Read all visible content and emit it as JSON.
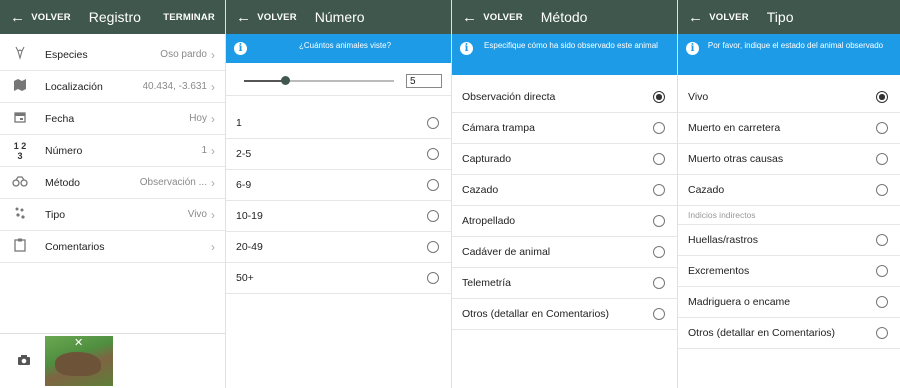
{
  "registro": {
    "back_label": "VOLVER",
    "title": "Registro",
    "action": "TERMINAR",
    "items": [
      {
        "icon": "deer-icon",
        "label": "Especies",
        "value": "Oso pardo"
      },
      {
        "icon": "map-icon",
        "label": "Localización",
        "value": "40.434, -3.631"
      },
      {
        "icon": "calendar-icon",
        "label": "Fecha",
        "value": "Hoy"
      },
      {
        "icon": "numbers-icon",
        "label": "Número",
        "value": "1"
      },
      {
        "icon": "binoculars-icon",
        "label": "Método",
        "value": "Observación ..."
      },
      {
        "icon": "paw-icon",
        "label": "Tipo",
        "value": "Vivo"
      },
      {
        "icon": "clipboard-icon",
        "label": "Comentarios",
        "value": ""
      }
    ],
    "icon_numbers": "1 2 3"
  },
  "numero": {
    "back_label": "VOLVER",
    "title": "Número",
    "info": "¿Cuántos animales viste?",
    "slider_value": "5",
    "slider_fraction": 0.27,
    "options": [
      {
        "label": "1",
        "selected": false
      },
      {
        "label": "2-5",
        "selected": false
      },
      {
        "label": "6-9",
        "selected": false
      },
      {
        "label": "10-19",
        "selected": false
      },
      {
        "label": "20-49",
        "selected": false
      },
      {
        "label": "50+",
        "selected": false
      }
    ]
  },
  "metodo": {
    "back_label": "VOLVER",
    "title": "Método",
    "info": "Especifique cómo ha sido observado este animal",
    "options": [
      {
        "label": "Observación directa",
        "selected": true
      },
      {
        "label": "Cámara trampa",
        "selected": false
      },
      {
        "label": "Capturado",
        "selected": false
      },
      {
        "label": "Cazado",
        "selected": false
      },
      {
        "label": "Atropellado",
        "selected": false
      },
      {
        "label": "Cadáver de animal",
        "selected": false
      },
      {
        "label": "Telemetría",
        "selected": false
      },
      {
        "label": "Otros (detallar en Comentarios)",
        "selected": false
      }
    ]
  },
  "tipo": {
    "back_label": "VOLVER",
    "title": "Tipo",
    "info": "Por favor, indique el estado del animal observado",
    "options_direct": [
      {
        "label": "Vivo",
        "selected": true
      },
      {
        "label": "Muerto en carretera",
        "selected": false
      },
      {
        "label": "Muerto otras causas",
        "selected": false
      },
      {
        "label": "Cazado",
        "selected": false
      }
    ],
    "section_label": "Indicios indirectos",
    "options_indirect": [
      {
        "label": "Huellas/rastros",
        "selected": false
      },
      {
        "label": "Excrementos",
        "selected": false
      },
      {
        "label": "Madriguera o encame",
        "selected": false
      },
      {
        "label": "Otros (detallar en Comentarios)",
        "selected": false
      }
    ]
  },
  "colors": {
    "topbar": "#3f574d",
    "info": "#1e9be6"
  }
}
